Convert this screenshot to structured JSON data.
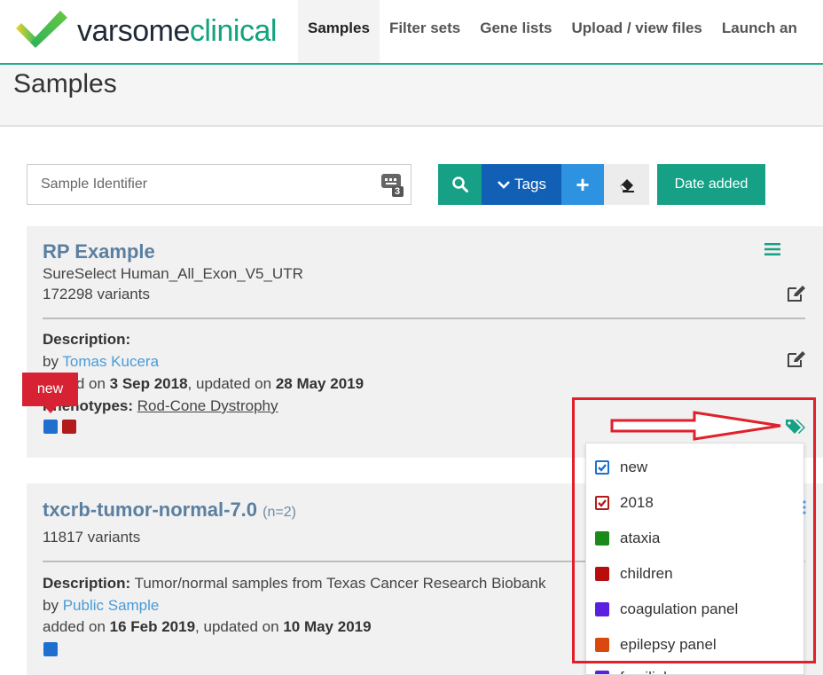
{
  "brand": {
    "part1": "varsome",
    "part2": "clinical"
  },
  "nav": [
    {
      "label": "Samples",
      "active": true
    },
    {
      "label": "Filter sets",
      "active": false
    },
    {
      "label": "Gene lists",
      "active": false
    },
    {
      "label": "Upload / view files",
      "active": false
    },
    {
      "label": "Launch an",
      "active": false
    }
  ],
  "page": {
    "title": "Samples"
  },
  "search": {
    "placeholder": "Sample Identifier",
    "value": "",
    "kb_badge": "3"
  },
  "toolbar": {
    "search_icon": "search-icon",
    "tags_label": "Tags",
    "add_label": "+",
    "eraser_icon": "eraser-icon",
    "date_label": "Date added"
  },
  "samples": [
    {
      "title": "RP Example",
      "count": "",
      "kit": "SureSelect Human_All_Exon_V5_UTR",
      "variants": "172298 variants",
      "description_label": "Description:",
      "description": "",
      "by_label": "by",
      "author": "Tomas Kucera",
      "added_label": "added on",
      "added": "3 Sep 2018",
      "updated_label": ", updated on",
      "updated": "28 May 2019",
      "phenotypes_label": "Phenotypes:",
      "phenotypes": "Rod-Cone Dystrophy",
      "tag_colors": [
        "#1f6fce",
        "#b31b1b"
      ]
    },
    {
      "title": "txcrb-tumor-normal-7.0",
      "count": "(n=2)",
      "kit": "",
      "variants": "11817 variants",
      "description_label": "Description:",
      "description": " Tumor/normal samples from Texas Cancer Research Biobank",
      "by_label": "by",
      "author": "Public Sample",
      "added_label": "added on",
      "added": "16 Feb 2019",
      "updated_label": ", updated on",
      "updated": "10 May 2019",
      "tag_colors": [
        "#1f6fce"
      ]
    }
  ],
  "badge": {
    "label": "new"
  },
  "tag_dropdown": [
    {
      "label": "new",
      "color": "#1f6fce",
      "checked": true
    },
    {
      "label": "2018",
      "color": "#b31b1b",
      "checked": true
    },
    {
      "label": "ataxia",
      "color": "#1b8a1b",
      "checked": false
    },
    {
      "label": "children",
      "color": "#b80d0d",
      "checked": false
    },
    {
      "label": "coagulation panel",
      "color": "#5b1fe0",
      "checked": false
    },
    {
      "label": "epilepsy panel",
      "color": "#d9480f",
      "checked": false
    },
    {
      "label": "familial",
      "color": "#5b1fe0",
      "checked": false
    }
  ],
  "colors": {
    "accent": "#16a085",
    "primary": "#1260b5",
    "link": "#4a9bd6",
    "highlight": "#e0202a"
  }
}
